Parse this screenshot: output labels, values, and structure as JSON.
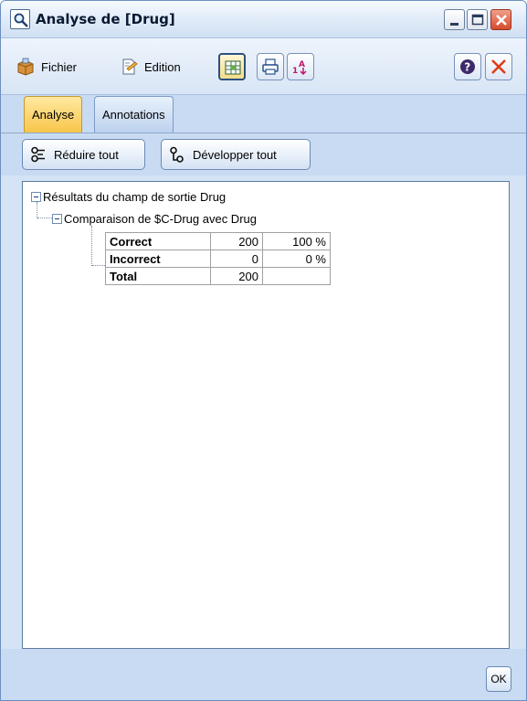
{
  "window": {
    "title": "Analyse de [Drug]"
  },
  "toolbar": {
    "menu_file": "Fichier",
    "menu_edit": "Edition"
  },
  "tabs": [
    {
      "label": "Analyse",
      "active": true
    },
    {
      "label": "Annotations",
      "active": false
    }
  ],
  "actions": {
    "collapse_all": "Réduire tout",
    "expand_all": "Développer tout"
  },
  "results": {
    "root_label": "Résultats du champ de sortie Drug",
    "comparison_label": "Comparaison de $C-Drug avec Drug",
    "rows": [
      {
        "label": "Correct",
        "count": "200",
        "percent": "100 %"
      },
      {
        "label": "Incorrect",
        "count": "0",
        "percent": "0 %"
      },
      {
        "label": "Total",
        "count": "200",
        "percent": ""
      }
    ]
  },
  "footer": {
    "ok_label": "OK"
  },
  "icons": {
    "window": "magnifier-icon",
    "file": "file-box-icon",
    "edit": "edit-page-icon",
    "insert": "insert-table-icon",
    "print": "print-icon",
    "sort": "sort-icon",
    "help": "help-icon",
    "close": "close-x-icon",
    "collapse": "collapse-icon",
    "expand": "expand-icon"
  },
  "colors": {
    "active_tab": "#f8c54b",
    "panel": "#c8dbf2",
    "close_accent": "#e03a12"
  }
}
